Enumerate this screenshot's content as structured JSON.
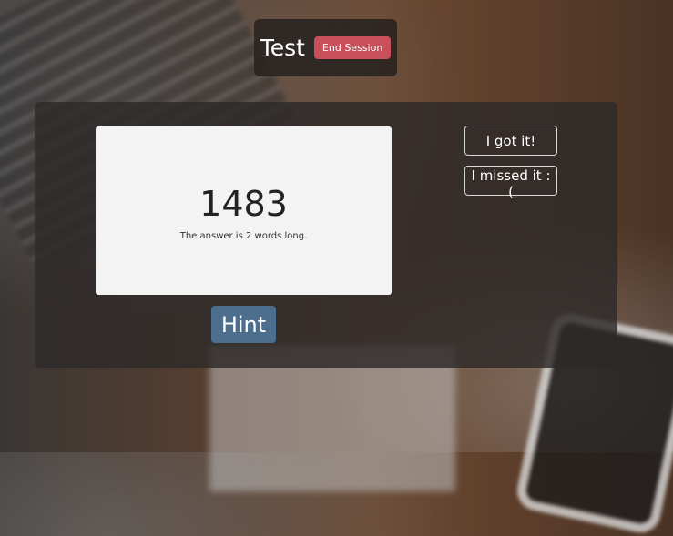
{
  "header": {
    "title": "Test",
    "end_session_label": "End Session"
  },
  "card": {
    "number": "1483",
    "hint_text": "The answer is 2 words long."
  },
  "actions": {
    "hint_label": "Hint",
    "got_it_label": "I got it!",
    "missed_it_label": "I missed it :("
  },
  "colors": {
    "end_session": "#c9505a",
    "hint": "#4e6e8e"
  }
}
